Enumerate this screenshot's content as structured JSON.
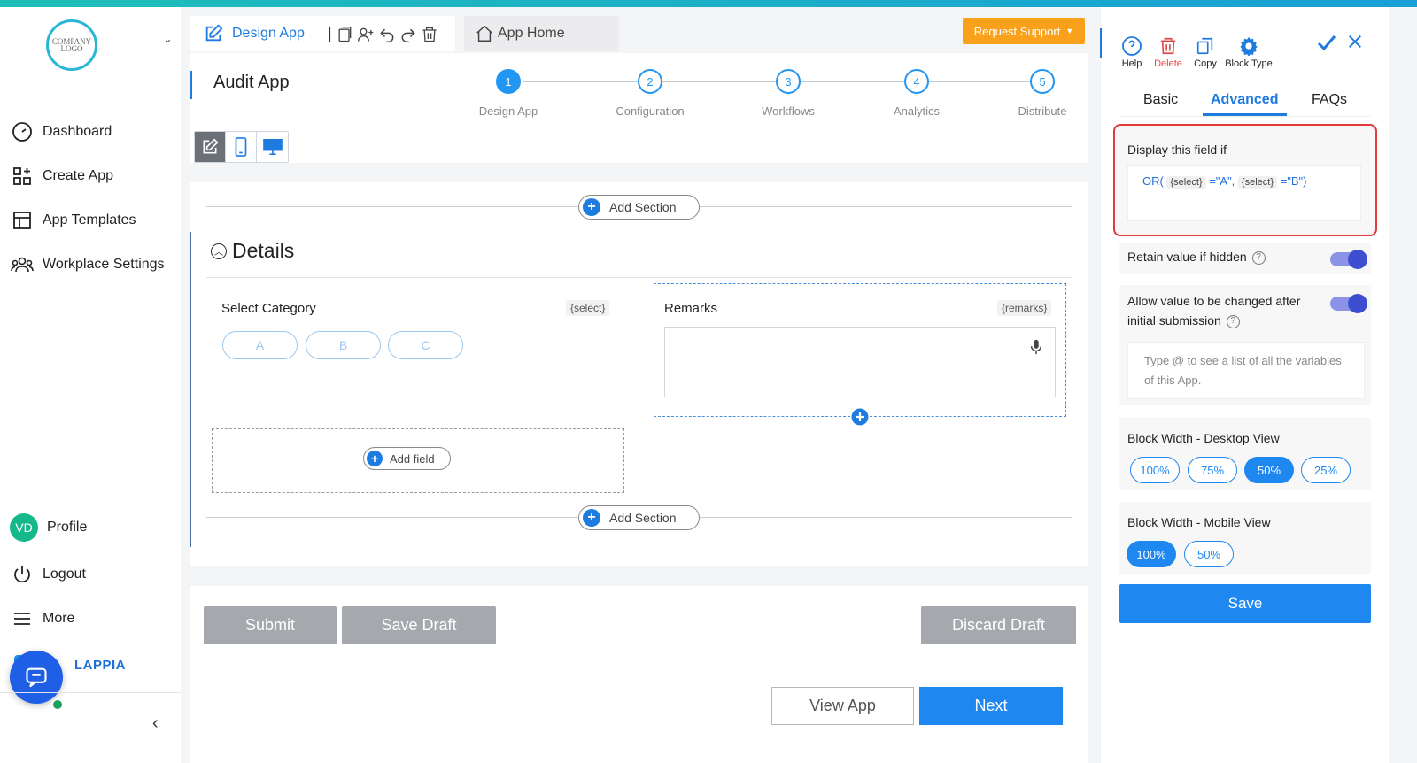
{
  "sidebar": {
    "logo_text": "COMPANY LOGO",
    "nav": [
      {
        "label": "Dashboard",
        "icon": "dashboard-gauge-icon"
      },
      {
        "label": "Create App",
        "icon": "grid-plus-icon"
      },
      {
        "label": "App Templates",
        "icon": "template-icon"
      },
      {
        "label": "Workplace Settings",
        "icon": "users-icon"
      }
    ],
    "profile": {
      "initials": "VD",
      "label": "Profile"
    },
    "logout": "Logout",
    "more": "More",
    "brand": "LAPPIA"
  },
  "header": {
    "tab_title": "Design App",
    "app_home": "App Home",
    "request_support": "Request Support"
  },
  "app": {
    "title": "Audit App",
    "steps": [
      {
        "num": "1",
        "label": "Design App",
        "active": true
      },
      {
        "num": "2",
        "label": "Configuration",
        "active": false
      },
      {
        "num": "3",
        "label": "Workflows",
        "active": false
      },
      {
        "num": "4",
        "label": "Analytics",
        "active": false
      },
      {
        "num": "5",
        "label": "Distribute",
        "active": false
      }
    ]
  },
  "canvas": {
    "add_section": "Add Section",
    "section_title": "Details",
    "fields": {
      "category": {
        "label": "Select Category",
        "var": "{select}",
        "options": [
          "A",
          "B",
          "C"
        ]
      },
      "remarks": {
        "label": "Remarks",
        "var": "{remarks}"
      }
    },
    "add_field": "Add field"
  },
  "footer": {
    "submit": "Submit",
    "save_draft": "Save Draft",
    "discard_draft": "Discard Draft",
    "view_app": "View App",
    "next": "Next"
  },
  "panel": {
    "tools": {
      "help": "Help",
      "delete": "Delete",
      "copy": "Copy",
      "block_type": "Block Type"
    },
    "tabs": [
      "Basic",
      "Advanced",
      "FAQs"
    ],
    "active_tab": "Advanced",
    "display_if": {
      "label": "Display this field if",
      "expr_prefix": "OR(",
      "chip1": "{select}",
      "mid1": "=\"A\",",
      "chip2": "{select}",
      "mid2": "=\"B\")"
    },
    "retain_hidden": {
      "label": "Retain value if hidden",
      "on": true
    },
    "allow_change": {
      "label1": "Allow value to be changed after",
      "label2": "initial submission",
      "on": true
    },
    "allow_change_placeholder": "Type @ to see a list of all the variables of this App.",
    "desktop_width": {
      "label": "Block Width - Desktop View",
      "options": [
        "100%",
        "75%",
        "50%",
        "25%"
      ],
      "selected": "50%"
    },
    "mobile_width": {
      "label": "Block Width - Mobile View",
      "options": [
        "100%",
        "50%"
      ],
      "selected": "100%"
    },
    "save": "Save"
  }
}
